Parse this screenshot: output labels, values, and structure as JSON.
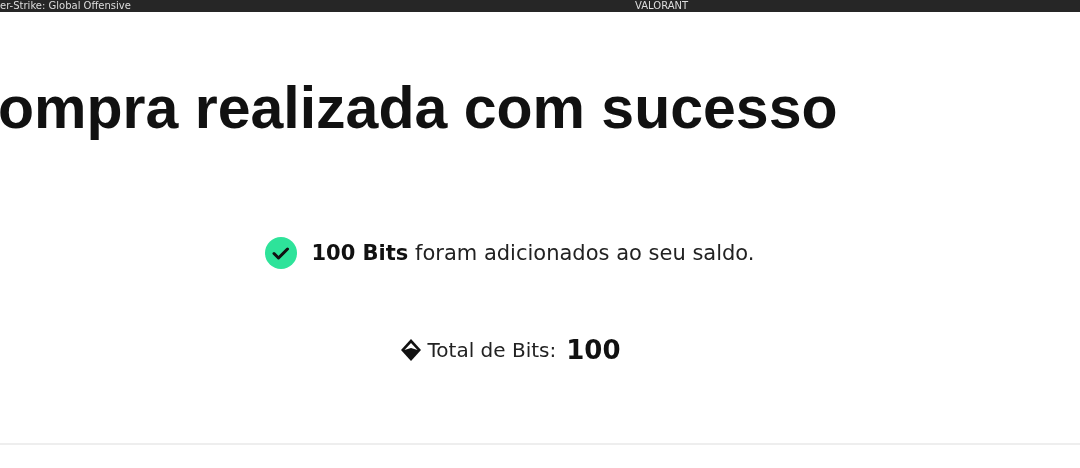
{
  "background_tabs": [
    "er-Strike: Global Offensive",
    "VALORANT"
  ],
  "dialog": {
    "title": "ompra realizada com sucesso",
    "message": "**100 Bits** foram adicionados ao seu saldo.",
    "total_label": "Total de Bits:",
    "total_value": "100"
  }
}
